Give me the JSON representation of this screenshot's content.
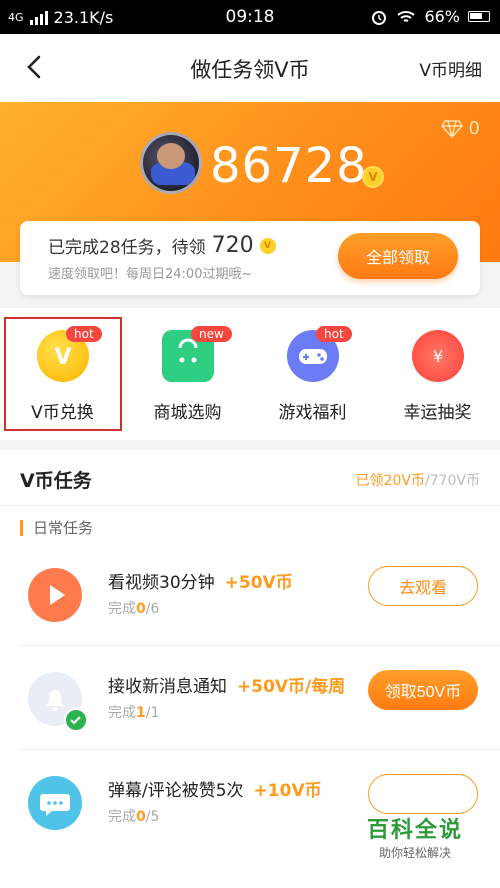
{
  "status_bar": {
    "network": "4G",
    "speed": "23.1K/s",
    "time": "09:18",
    "battery": "66%"
  },
  "nav": {
    "title": "做任务领V币",
    "right_label": "V币明细"
  },
  "hero": {
    "gem_count": "0",
    "balance": "86728",
    "coin_letter": "V"
  },
  "claim_card": {
    "completed_text": "已完成28任务，待领",
    "pending_amount": "720",
    "hint": "速度领取吧！每周日24:00过期哦~",
    "button": "全部领取"
  },
  "quick_actions": [
    {
      "label": "V币兑换",
      "badge": "hot",
      "icon": "v-coin-icon",
      "color": "#ffc21a",
      "selected": true
    },
    {
      "label": "商城选购",
      "badge": "new",
      "icon": "shopping-bag-icon",
      "color": "#2fcf83"
    },
    {
      "label": "游戏福利",
      "badge": "hot",
      "icon": "gamepad-icon",
      "color": "#6b7cf6"
    },
    {
      "label": "幸运抽奖",
      "badge": "",
      "icon": "lucky-draw-icon",
      "color": "#ff5c4d"
    }
  ],
  "tasks_section": {
    "title": "V币任务",
    "claimed": "已领20V币",
    "total": "/770V币",
    "subtitle": "日常任务",
    "items": [
      {
        "name": "看视频30分钟",
        "reward": "+50V币",
        "progress_label": "完成",
        "done": "0",
        "total": "/6",
        "button": "去观看",
        "icon": "play-icon"
      },
      {
        "name": "接收新消息通知",
        "reward": "+50V币/每周",
        "progress_label": "完成",
        "done": "1",
        "total": "/1",
        "button": "领取50V币",
        "icon": "bell-icon"
      },
      {
        "name": "弹幕/评论被赞5次",
        "reward": "+10V币",
        "progress_label": "完成",
        "done": "0",
        "total": "/5",
        "button": "",
        "icon": "comment-icon"
      }
    ]
  },
  "watermark": {
    "title": "百科全说",
    "subtitle": "助你轻松解决"
  }
}
